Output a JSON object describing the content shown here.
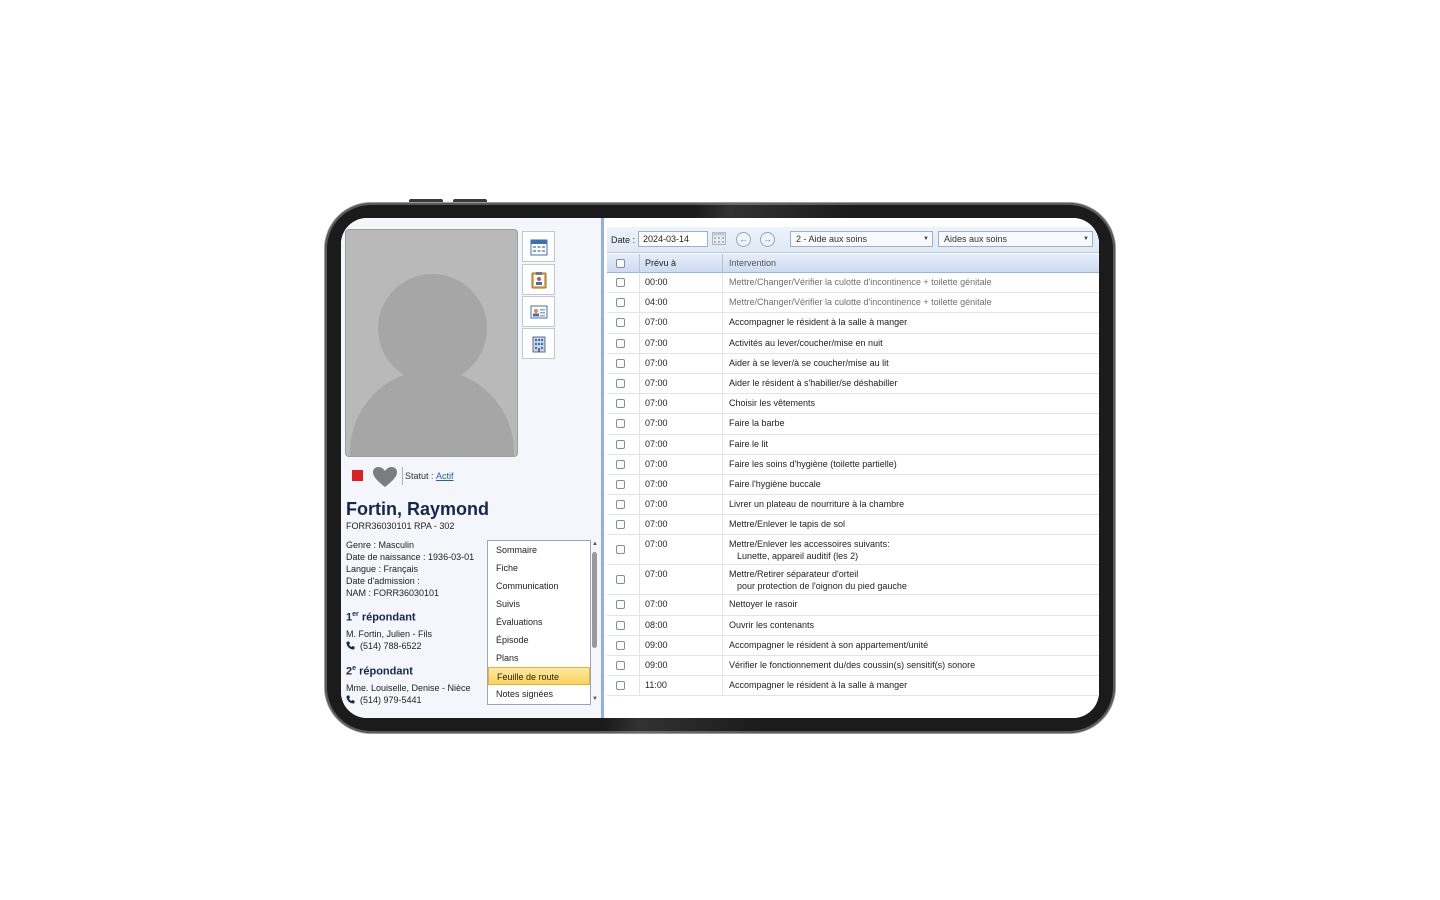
{
  "patient": {
    "status_label": "Statut :",
    "status_value": "Actif",
    "name": "Fortin, Raymond",
    "id_line": "FORR36030101 RPA - 302",
    "info": [
      "Genre : Masculin",
      "Date de naissance : 1936-03-01",
      "Langue : Français",
      "Date d'admission :",
      "NAM : FORR36030101"
    ]
  },
  "respondents": [
    {
      "num": "1",
      "sup": "er",
      "title": "répondant",
      "person": "M. Fortin, Julien - Fils",
      "phone": "(514) 788-6522"
    },
    {
      "num": "2",
      "sup": "e",
      "title": "répondant",
      "person": "Mme. Louiselle, Denise - Nièce",
      "phone": "(514) 979-5441"
    }
  ],
  "side_buttons": [
    "calendar-icon",
    "clipboard-icon",
    "contact-card-icon",
    "building-icon"
  ],
  "nav": {
    "items": [
      "Sommaire",
      "Fiche",
      "Communication",
      "Suivis",
      "Évaluations",
      "Épisode",
      "Plans",
      "Feuille de route",
      "Notes signées"
    ],
    "active": "Feuille de route"
  },
  "toolbar": {
    "date_label": "Date :",
    "date_value": "2024-03-14",
    "unit_combo": "2 - Aide aux soins",
    "role_combo": "Aides aux soins"
  },
  "grid": {
    "col_time": "Prévu à",
    "col_intervention": "Intervention",
    "rows": [
      {
        "time": "00:00",
        "text": "Mettre/Changer/Vérifier la culotte d'incontinence + toilette génitale",
        "faded": true
      },
      {
        "time": "04:00",
        "text": "Mettre/Changer/Vérifier la culotte d'incontinence + toilette génitale",
        "faded": true
      },
      {
        "time": "07:00",
        "text": "Accompagner le résident à la salle à manger"
      },
      {
        "time": "07:00",
        "text": "Activités au lever/coucher/mise en nuit"
      },
      {
        "time": "07:00",
        "text": "Aider à se lever/à se coucher/mise au lit"
      },
      {
        "time": "07:00",
        "text": "Aider le résident à s'habiller/se déshabiller"
      },
      {
        "time": "07:00",
        "text": "Choisir les vêtements"
      },
      {
        "time": "07:00",
        "text": "Faire la barbe"
      },
      {
        "time": "07:00",
        "text": "Faire le lit"
      },
      {
        "time": "07:00",
        "text": "Faire les soins d'hygiène (toilette partielle)"
      },
      {
        "time": "07:00",
        "text": "Faire l'hygiène buccale"
      },
      {
        "time": "07:00",
        "text": "Livrer un plateau de nourriture à la chambre"
      },
      {
        "time": "07:00",
        "text": "Mettre/Enlever le tapis de sol"
      },
      {
        "time": "07:00",
        "text": "Mettre/Enlever les accessoires suivants:",
        "sub": "Lunette, appareil auditif (les 2)"
      },
      {
        "time": "07:00",
        "text": "Mettre/Retirer séparateur d'orteil",
        "sub": "pour protection de l'oignon du pied gauche"
      },
      {
        "time": "07:00",
        "text": "Nettoyer le rasoir"
      },
      {
        "time": "08:00",
        "text": "Ouvrir les contenants"
      },
      {
        "time": "09:00",
        "text": "Accompagner le résident à son appartement/unité"
      },
      {
        "time": "09:00",
        "text": "Vérifier le fonctionnement du/des coussin(s) sensitif(s) sonore"
      },
      {
        "time": "11:00",
        "text": "Accompagner le résident à la salle à manger"
      }
    ]
  },
  "colors": {
    "accent_blue": "#8fb2e0",
    "name_navy": "#17264d",
    "status_red": "#e02020",
    "active_yellow": "#fbd25a"
  }
}
